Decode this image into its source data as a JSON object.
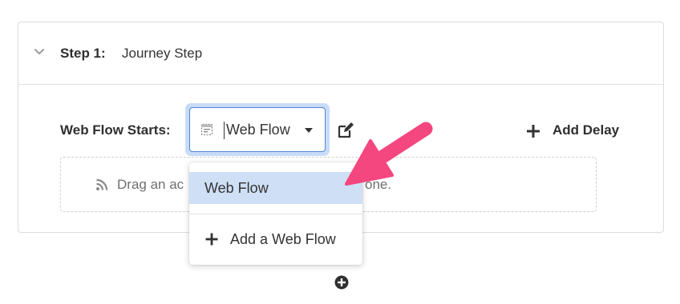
{
  "step": {
    "label": "Step 1:",
    "name": "Journey Step"
  },
  "web_flow": {
    "label": "Web Flow Starts:",
    "selected": "Web Flow"
  },
  "actions": {
    "add_delay": "Add Delay"
  },
  "dropzone": {
    "text": "Drag an ac",
    "text_tail": "one."
  },
  "menu": {
    "items": [
      {
        "label": "Web Flow"
      },
      {
        "label": "Add a Web Flow"
      }
    ]
  },
  "colors": {
    "accent_arrow": "#f4467f",
    "selection_bg": "#cfe0f6",
    "focus_border": "#4d86d6"
  },
  "icons": {
    "expand": "chevron-down-icon",
    "flow": "web-flow-icon",
    "edit": "edit-icon",
    "add": "plus-icon",
    "feed": "rss-icon",
    "add_step": "plus-circle-icon"
  }
}
